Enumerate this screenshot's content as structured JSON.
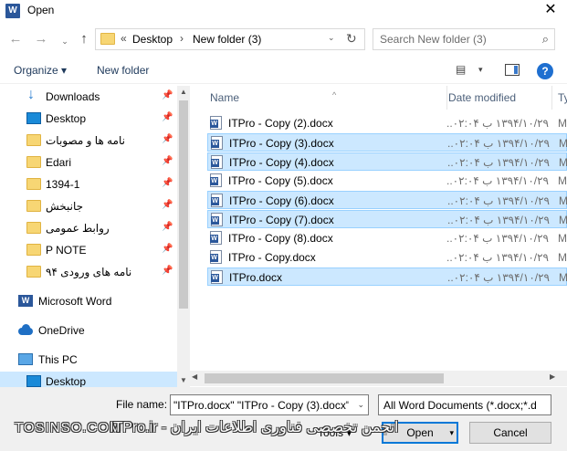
{
  "window": {
    "title": "Open",
    "app_icon": "word-icon",
    "close": "✕"
  },
  "navbar": {
    "back": "←",
    "forward": "→",
    "recent": "⌄",
    "up": "↑",
    "address": {
      "prefix": "«",
      "segments": [
        "Desktop",
        "New folder (3)"
      ],
      "dropdown": "⌄",
      "refresh": "↻"
    },
    "search_placeholder": "Search New folder (3)",
    "search_icon": "⌕"
  },
  "toolbar": {
    "organize": "Organize ▾",
    "new_folder": "New folder",
    "view_icon": "▤",
    "view_dropdown": "▾",
    "help": "?"
  },
  "sidebar": {
    "items": [
      {
        "label": "Downloads",
        "icon": "download-icon",
        "pinned": true,
        "rtl": false
      },
      {
        "label": "Desktop",
        "icon": "desktop-icon",
        "pinned": true,
        "rtl": false
      },
      {
        "label": "نامه ها و مصوبات",
        "icon": "folder-icon",
        "pinned": true,
        "rtl": true
      },
      {
        "label": "Edari",
        "icon": "folder-icon",
        "pinned": true,
        "rtl": false
      },
      {
        "label": "1394-1",
        "icon": "folder-icon",
        "pinned": true,
        "rtl": false
      },
      {
        "label": "جانبخش",
        "icon": "folder-icon",
        "pinned": true,
        "rtl": true
      },
      {
        "label": "روابط عمومی",
        "icon": "folder-icon",
        "pinned": true,
        "rtl": true
      },
      {
        "label": "P NOTE",
        "icon": "folder-icon",
        "pinned": true,
        "rtl": false
      },
      {
        "label": "نامه های ورودی ۹۴",
        "icon": "folder-icon",
        "pinned": true,
        "rtl": true
      },
      {
        "label": "Microsoft Word",
        "icon": "word-icon",
        "pinned": false,
        "rtl": false
      },
      {
        "label": "OneDrive",
        "icon": "onedrive-icon",
        "pinned": false,
        "rtl": false
      },
      {
        "label": "This PC",
        "icon": "pc-icon",
        "pinned": false,
        "rtl": false
      },
      {
        "label": "Desktop",
        "icon": "desktop-icon",
        "pinned": false,
        "rtl": false
      }
    ],
    "pin_glyph": "📌"
  },
  "filelist": {
    "columns": [
      "Name",
      "Date modified",
      "Ty"
    ],
    "sort_indicator": "^",
    "files": [
      {
        "name": "ITPro - Copy (2).docx",
        "date": "۱۳۹۴/۱۰/۲۹ ب ۰۲:۰۴...",
        "type": "M",
        "selected": false
      },
      {
        "name": "ITPro - Copy (3).docx",
        "date": "۱۳۹۴/۱۰/۲۹ ب ۰۲:۰۴...",
        "type": "M",
        "selected": true
      },
      {
        "name": "ITPro - Copy (4).docx",
        "date": "۱۳۹۴/۱۰/۲۹ ب ۰۲:۰۴...",
        "type": "M",
        "selected": true
      },
      {
        "name": "ITPro - Copy (5).docx",
        "date": "۱۳۹۴/۱۰/۲۹ ب ۰۲:۰۴...",
        "type": "M",
        "selected": false
      },
      {
        "name": "ITPro - Copy (6).docx",
        "date": "۱۳۹۴/۱۰/۲۹ ب ۰۲:۰۴...",
        "type": "M",
        "selected": true
      },
      {
        "name": "ITPro - Copy (7).docx",
        "date": "۱۳۹۴/۱۰/۲۹ ب ۰۲:۰۴...",
        "type": "M",
        "selected": true
      },
      {
        "name": "ITPro - Copy (8).docx",
        "date": "۱۳۹۴/۱۰/۲۹ ب ۰۲:۰۴...",
        "type": "M",
        "selected": false
      },
      {
        "name": "ITPro - Copy.docx",
        "date": "۱۳۹۴/۱۰/۲۹ ب ۰۲:۰۴...",
        "type": "M",
        "selected": false
      },
      {
        "name": "ITPro.docx",
        "date": "۱۳۹۴/۱۰/۲۹ ب ۰۲:۰۴...",
        "type": "M",
        "selected": true
      }
    ]
  },
  "bottom": {
    "filename_label": "File name:",
    "filename_value": "\"ITPro.docx\" \"ITPro - Copy (3).docx\"",
    "filetype_value": "All Word Documents (*.docx;*.d",
    "tools": "Tools ▾",
    "open": "Open",
    "cancel": "Cancel"
  },
  "watermark": {
    "site": "TOSINSO.COM",
    "text": "ITPro.ir - انجمن تخصصی فناوری اطلاعات ایران"
  }
}
